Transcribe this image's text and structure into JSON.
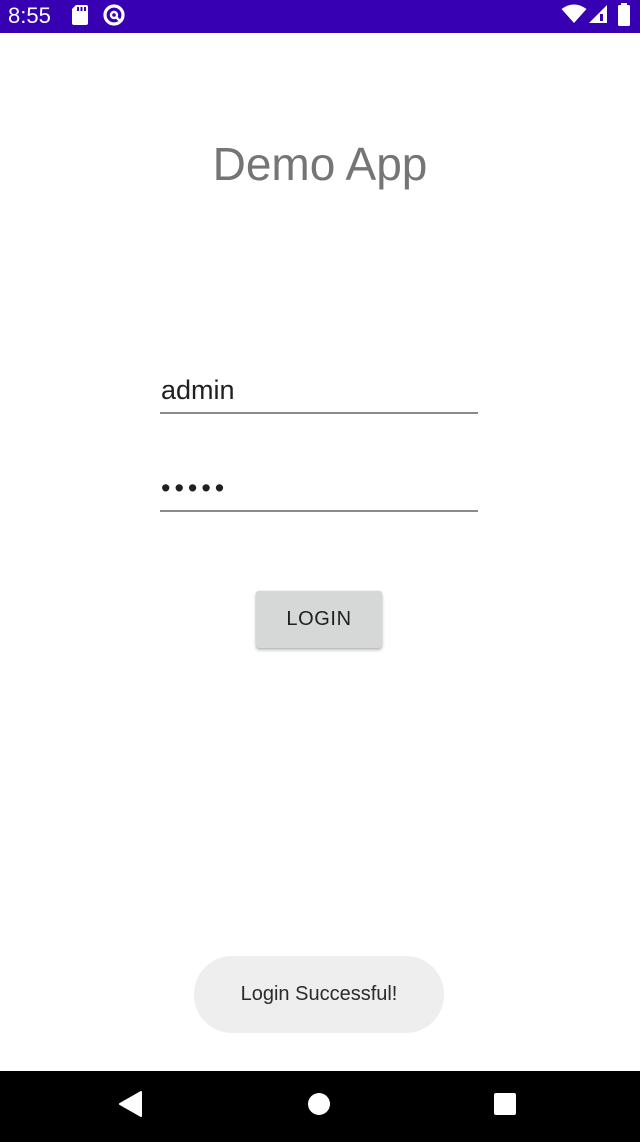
{
  "status_bar": {
    "time": "8:55",
    "background": "#3700b3",
    "icons": [
      "sd-card-icon",
      "data-saver-icon",
      "wifi-icon",
      "cell-signal-icon",
      "battery-icon"
    ]
  },
  "app": {
    "title": "Demo App"
  },
  "login_form": {
    "username_value": "admin",
    "password_value": "•••••",
    "login_label": "LOGIN"
  },
  "toast": {
    "message": "Login Successful!"
  },
  "nav_bar": {
    "icons": [
      "back-icon",
      "home-icon",
      "recents-icon"
    ]
  }
}
